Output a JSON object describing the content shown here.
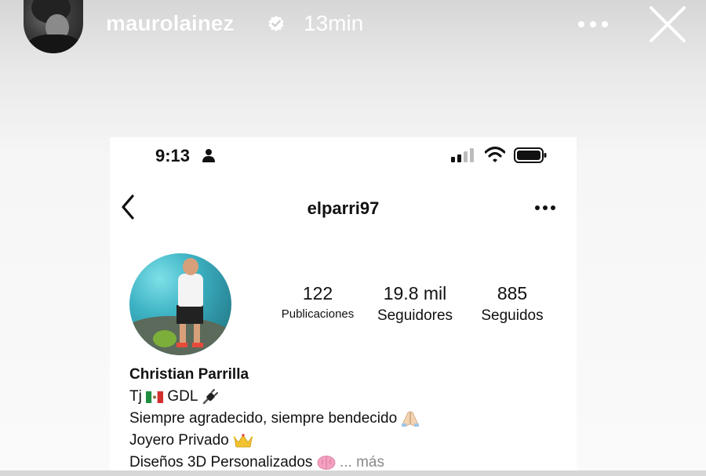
{
  "story": {
    "username": "maurolainez",
    "time": "13min",
    "icons": {
      "avatar": "story-avatar",
      "verified": "verified-badge-icon",
      "more": "more-options-icon",
      "close": "close-icon"
    }
  },
  "screenshot": {
    "status_bar": {
      "time": "9:13",
      "icons": [
        "person-icon",
        "signal-icon",
        "wifi-icon",
        "battery-icon"
      ]
    },
    "profile": {
      "username": "elparri97",
      "stats": [
        {
          "value": "122",
          "label": "Publicaciones"
        },
        {
          "value": "19.8 mil",
          "label": "Seguidores"
        },
        {
          "value": "885",
          "label": "Seguidos"
        }
      ],
      "name": "Christian Parrilla",
      "bio": {
        "line1_text": "Tj",
        "line1_text2": "GDL",
        "line2_text": "Siempre agradecido, siempre bendecido",
        "line3_text": "Joyero Privado",
        "line4_text": "Diseños 3D Personalizados",
        "more_text": "... más"
      },
      "bio_icons": [
        "mexico-flag-icon",
        "plug-icon",
        "praying-hands-icon",
        "crown-icon",
        "brain-icon"
      ]
    }
  },
  "colors": {
    "story_text": "#ffffff",
    "more_link": "#8a8a8a",
    "text": "#111111"
  }
}
